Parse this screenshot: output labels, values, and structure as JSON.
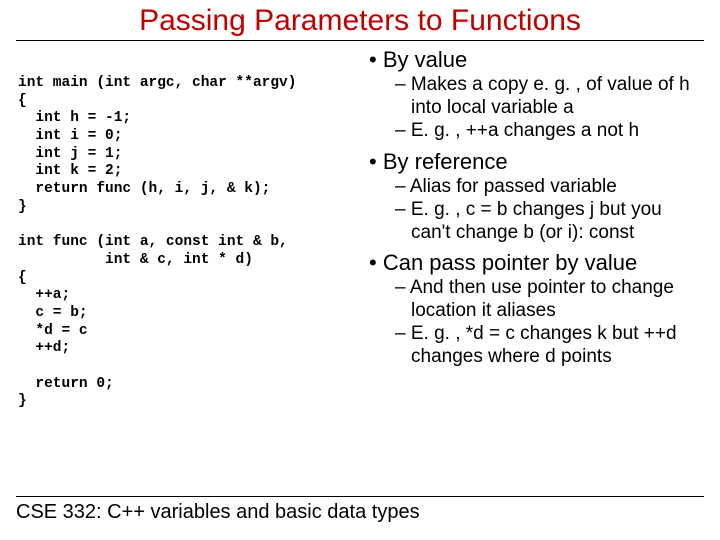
{
  "title": "Passing Parameters to Functions",
  "code": "int main (int argc, char **argv)\n{\n  int h = -1;\n  int i = 0;\n  int j = 1;\n  int k = 2;\n  return func (h, i, j, & k);\n}\n\nint func (int a, const int & b,\n          int & c, int * d)\n{\n  ++a;\n  c = b;\n  *d = c\n  ++d;\n\n  return 0;\n}",
  "bullets": [
    {
      "text": "By value",
      "sub": [
        "Makes a copy e. g. , of value of h into local variable a",
        "E. g. , ++a changes a not h"
      ]
    },
    {
      "text": "By reference",
      "sub": [
        "Alias for passed variable",
        "E. g. , c = b changes j but you can't change b (or i): const"
      ]
    },
    {
      "text": "Can pass pointer by value",
      "sub": [
        "And then use pointer to change location it aliases",
        "E. g. , *d = c changes k but ++d changes where d points"
      ]
    }
  ],
  "footer": "CSE 332: C++ variables and basic data types"
}
